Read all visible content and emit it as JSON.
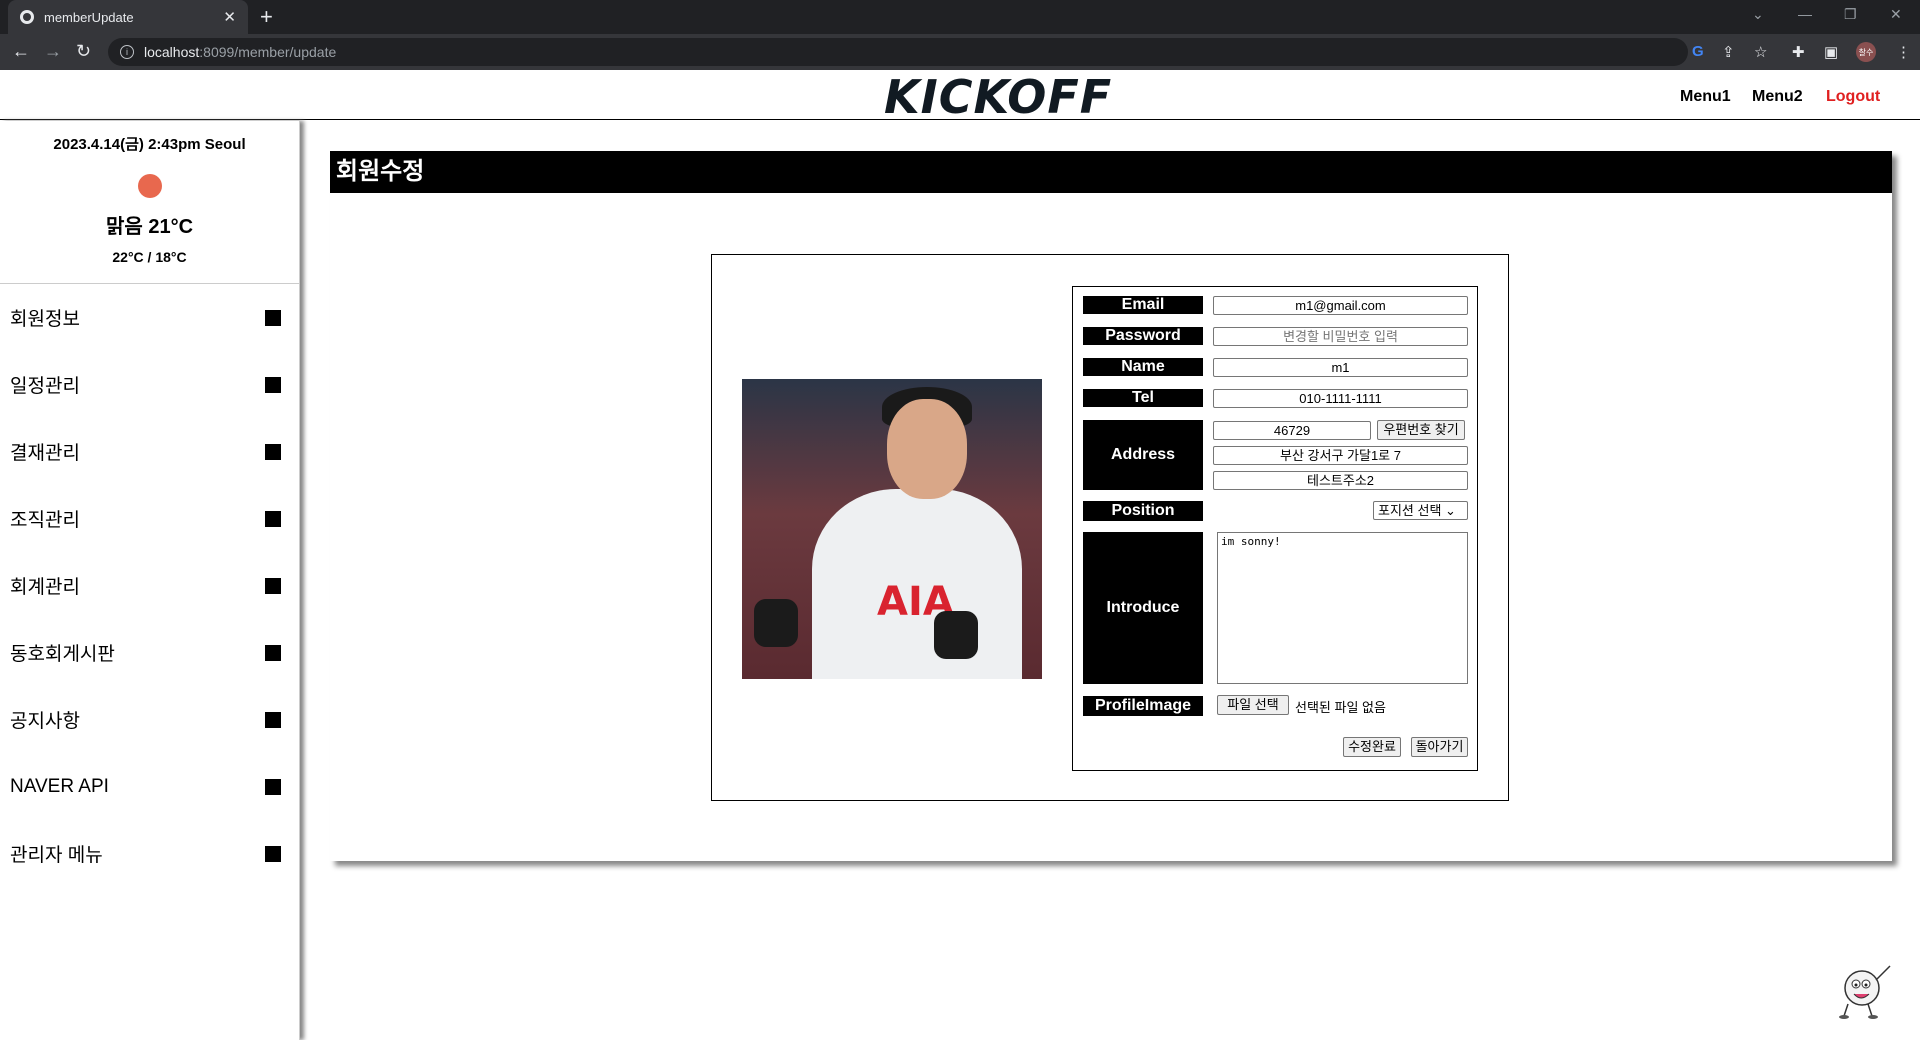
{
  "browser": {
    "tab_title": "memberUpdate",
    "url_host": "localhost",
    "url_path": ":8099/member/update",
    "profile_label": "찰수"
  },
  "header": {
    "logo": "KICKOFF",
    "menu1": "Menu1",
    "menu2": "Menu2",
    "logout": "Logout"
  },
  "weather": {
    "datetime": "2023.4.14(금) 2:43pm Seoul",
    "condition": "맑음 21°C",
    "range": "22°C / 18°C"
  },
  "sidebar": {
    "items": [
      {
        "label": "회원정보"
      },
      {
        "label": "일정관리"
      },
      {
        "label": "결재관리"
      },
      {
        "label": "조직관리"
      },
      {
        "label": "회계관리"
      },
      {
        "label": "동호회게시판"
      },
      {
        "label": "공지사항"
      },
      {
        "label": "NAVER API"
      },
      {
        "label": "관리자 메뉴"
      }
    ]
  },
  "main": {
    "title": "회원수정",
    "photo_text": "AIA",
    "form": {
      "email_label": "Email",
      "email_value": "m1@gmail.com",
      "password_label": "Password",
      "password_placeholder": "변경할 비밀번호 입력",
      "name_label": "Name",
      "name_value": "m1",
      "tel_label": "Tel",
      "tel_value": "010-1111-1111",
      "address_label": "Address",
      "zipcode_value": "46729",
      "zipcode_button": "우편번호 찾기",
      "address1_value": "부산 강서구 가달1로 7",
      "address2_value": "테스트주소2",
      "position_label": "Position",
      "position_select": "포지션 선택",
      "introduce_label": "Introduce",
      "introduce_value": "im sonny!",
      "profile_label": "ProfileImage",
      "file_button": "파일 선택",
      "file_status": "선택된 파일 없음",
      "submit_button": "수정완료",
      "back_button": "돌아가기"
    }
  }
}
